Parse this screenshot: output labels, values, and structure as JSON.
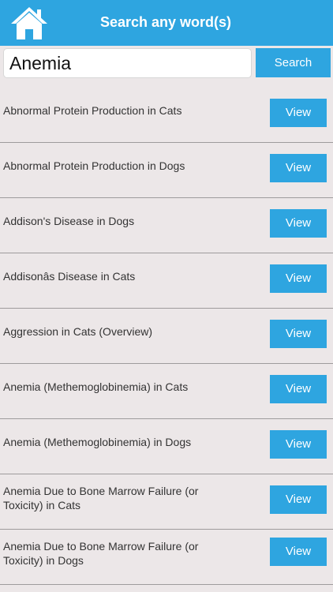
{
  "header": {
    "title": "Search any word(s)",
    "home_icon": "home-icon"
  },
  "search": {
    "value": "Anemia",
    "button_label": "Search"
  },
  "results": [
    {
      "title": "Abnormal Protein Production in Cats",
      "button": "View"
    },
    {
      "title": "Abnormal Protein Production in Dogs",
      "button": "View"
    },
    {
      "title": "Addison's Disease in Dogs",
      "button": "View"
    },
    {
      "title": "Addisonâs Disease in Cats",
      "button": "View"
    },
    {
      "title": "Aggression in Cats (Overview)",
      "button": "View"
    },
    {
      "title": "Anemia (Methemoglobinemia) in Cats",
      "button": "View"
    },
    {
      "title": "Anemia (Methemoglobinemia) in Dogs",
      "button": "View"
    },
    {
      "title": "Anemia Due to Bone Marrow Failure (or Toxicity) in Cats",
      "button": "View"
    },
    {
      "title": "Anemia Due to Bone Marrow Failure (or Toxicity) in Dogs",
      "button": "View"
    }
  ],
  "colors": {
    "accent": "#2ea5e0",
    "background": "#ece7e8",
    "divider": "#9e9b9c"
  }
}
